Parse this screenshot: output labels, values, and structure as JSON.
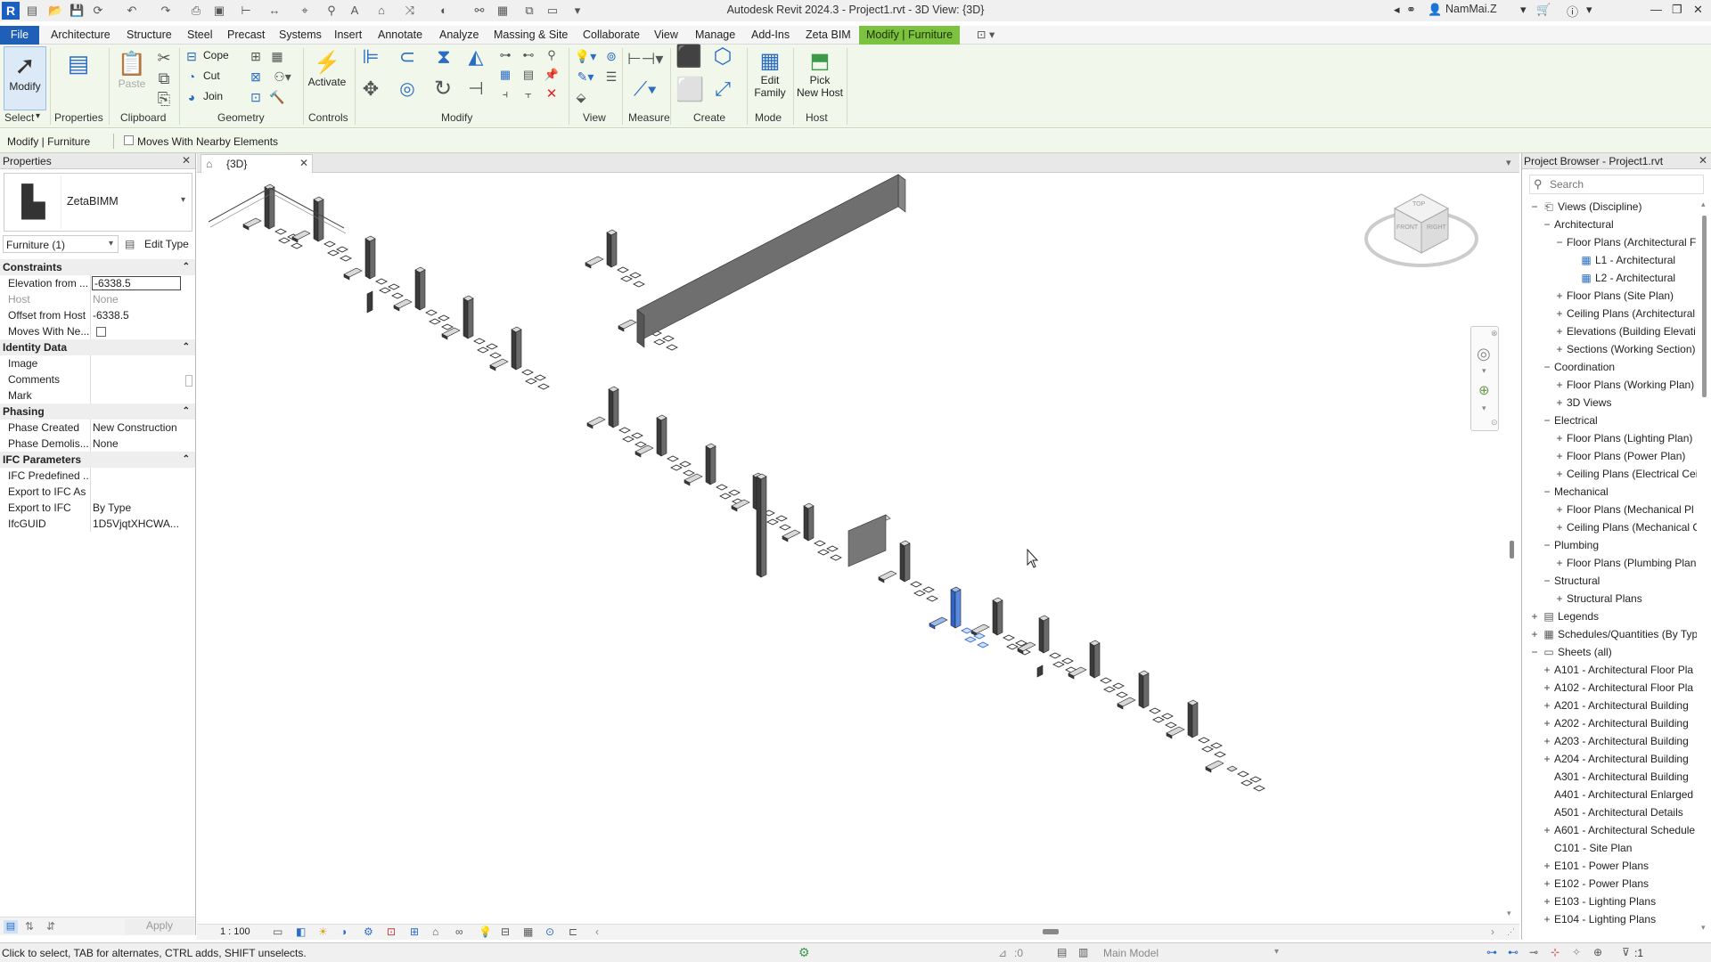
{
  "app": {
    "title": "Autodesk Revit 2024.3 - Project1.rvt - 3D View: {3D}",
    "user": "NamMai.Z",
    "logo": "R"
  },
  "menu": [
    "File",
    "Architecture",
    "Structure",
    "Steel",
    "Precast",
    "Systems",
    "Insert",
    "Annotate",
    "Analyze",
    "Massing & Site",
    "Collaborate",
    "View",
    "Manage",
    "Add-Ins",
    "Zeta BIM",
    "Modify | Furniture"
  ],
  "ribbon": {
    "panels": [
      "Select",
      "Properties",
      "Clipboard",
      "Geometry",
      "Controls",
      "Modify",
      "View",
      "Measure",
      "Create",
      "Mode",
      "Host"
    ],
    "modify_label": "Modify",
    "properties_label": "Properties",
    "paste_label": "Paste",
    "cope_label": "Cope",
    "cut_label": "Cut",
    "join_label": "Join",
    "activate_label": "Activate",
    "edit_family_line1": "Edit",
    "edit_family_line2": "Family",
    "pick_host_line1": "Pick",
    "pick_host_line2": "New Host"
  },
  "optionbar": {
    "context": "Modify | Furniture",
    "moves_with": "Moves With Nearby Elements"
  },
  "properties": {
    "title": "Properties",
    "type_name": "ZetaBIMM",
    "instance": "Furniture (1)",
    "edit_type": "Edit Type",
    "groups": {
      "constraints": "Constraints",
      "identity": "Identity Data",
      "phasing": "Phasing",
      "ifc": "IFC Parameters"
    },
    "rows": [
      {
        "k": "Elevation from ...",
        "v": "-6338.5"
      },
      {
        "k": "Host",
        "v": "None"
      },
      {
        "k": "Offset from Host",
        "v": "-6338.5"
      },
      {
        "k": "Moves With Ne...",
        "v": ""
      },
      {
        "k": "Image",
        "v": ""
      },
      {
        "k": "Comments",
        "v": ""
      },
      {
        "k": "Mark",
        "v": ""
      },
      {
        "k": "Phase Created",
        "v": "New Construction"
      },
      {
        "k": "Phase Demolis...",
        "v": "None"
      },
      {
        "k": "IFC Predefined ...",
        "v": ""
      },
      {
        "k": "Export to IFC As",
        "v": ""
      },
      {
        "k": "Export to IFC",
        "v": "By Type"
      },
      {
        "k": "IfcGUID",
        "v": "1D5VjqtXHCWA..."
      }
    ],
    "apply": "Apply"
  },
  "viewtab": {
    "name": "{3D}"
  },
  "viewbar": {
    "scale": "1 : 100"
  },
  "viewcube": {
    "top": "TOP",
    "front": "FRONT",
    "right": "RIGHT"
  },
  "browser": {
    "title": "Project Browser - Project1.rvt",
    "search_placeholder": "Search",
    "items": [
      {
        "t": "Views (Discipline)",
        "lvl": 0,
        "tog": "−",
        "ic": "views"
      },
      {
        "t": "Architectural",
        "lvl": 1,
        "tog": "−"
      },
      {
        "t": "Floor Plans (Architectural F",
        "lvl": 2,
        "tog": "−"
      },
      {
        "t": "L1 - Architectural",
        "lvl": 3,
        "ic": "plan"
      },
      {
        "t": "L2 - Architectural",
        "lvl": 3,
        "ic": "plan"
      },
      {
        "t": "Floor Plans (Site Plan)",
        "lvl": 2,
        "tog": "+"
      },
      {
        "t": "Ceiling Plans (Architectural",
        "lvl": 2,
        "tog": "+"
      },
      {
        "t": "Elevations (Building Elevati",
        "lvl": 2,
        "tog": "+"
      },
      {
        "t": "Sections (Working Section)",
        "lvl": 2,
        "tog": "+"
      },
      {
        "t": "Coordination",
        "lvl": 1,
        "tog": "−"
      },
      {
        "t": "Floor Plans (Working Plan)",
        "lvl": 2,
        "tog": "+"
      },
      {
        "t": "3D Views",
        "lvl": 2,
        "tog": "+"
      },
      {
        "t": "Electrical",
        "lvl": 1,
        "tog": "−"
      },
      {
        "t": "Floor Plans (Lighting Plan)",
        "lvl": 2,
        "tog": "+"
      },
      {
        "t": "Floor Plans (Power Plan)",
        "lvl": 2,
        "tog": "+"
      },
      {
        "t": "Ceiling Plans (Electrical Cei",
        "lvl": 2,
        "tog": "+"
      },
      {
        "t": "Mechanical",
        "lvl": 1,
        "tog": "−"
      },
      {
        "t": "Floor Plans (Mechanical Pl",
        "lvl": 2,
        "tog": "+"
      },
      {
        "t": "Ceiling Plans (Mechanical C",
        "lvl": 2,
        "tog": "+"
      },
      {
        "t": "Plumbing",
        "lvl": 1,
        "tog": "−"
      },
      {
        "t": "Floor Plans (Plumbing Plan",
        "lvl": 2,
        "tog": "+"
      },
      {
        "t": "Structural",
        "lvl": 1,
        "tog": "−"
      },
      {
        "t": "Structural Plans",
        "lvl": 2,
        "tog": "+"
      },
      {
        "t": "Legends",
        "lvl": 0,
        "tog": "+",
        "ic": "legend"
      },
      {
        "t": "Schedules/Quantities (By Typ",
        "lvl": 0,
        "tog": "+",
        "ic": "sched"
      },
      {
        "t": "Sheets (all)",
        "lvl": 0,
        "tog": "−",
        "ic": "sheet"
      },
      {
        "t": "A101 - Architectural Floor Pla",
        "lvl": 1,
        "tog": "+"
      },
      {
        "t": "A102 - Architectural Floor Pla",
        "lvl": 1,
        "tog": "+"
      },
      {
        "t": "A201 - Architectural Building",
        "lvl": 1,
        "tog": "+"
      },
      {
        "t": "A202 - Architectural Building",
        "lvl": 1,
        "tog": "+"
      },
      {
        "t": "A203 - Architectural Building",
        "lvl": 1,
        "tog": "+"
      },
      {
        "t": "A204 - Architectural Building",
        "lvl": 1,
        "tog": "+"
      },
      {
        "t": "A301 - Architectural Building",
        "lvl": 1
      },
      {
        "t": "A401 - Architectural Enlarged",
        "lvl": 1
      },
      {
        "t": "A501 - Architectural Details",
        "lvl": 1
      },
      {
        "t": "A601 - Architectural Schedule",
        "lvl": 1,
        "tog": "+"
      },
      {
        "t": "C101 - Site Plan",
        "lvl": 1
      },
      {
        "t": "E101 - Power Plans",
        "lvl": 1,
        "tog": "+"
      },
      {
        "t": "E102 - Power Plans",
        "lvl": 1,
        "tog": "+"
      },
      {
        "t": "E103 - Lighting Plans",
        "lvl": 1,
        "tog": "+"
      },
      {
        "t": "E104 - Lighting Plans",
        "lvl": 1,
        "tog": "+"
      }
    ]
  },
  "status": {
    "hint": "Click to select, TAB for alternates, CTRL adds, SHIFT unselects.",
    "model": "Main Model",
    "zero": ":0",
    "filter": ":1"
  },
  "colors": {
    "accent": "#1f5fb8",
    "context_tab": "#7bc240",
    "ribbon_bg": "#f1f7ea",
    "selected": "#3b73d6"
  }
}
